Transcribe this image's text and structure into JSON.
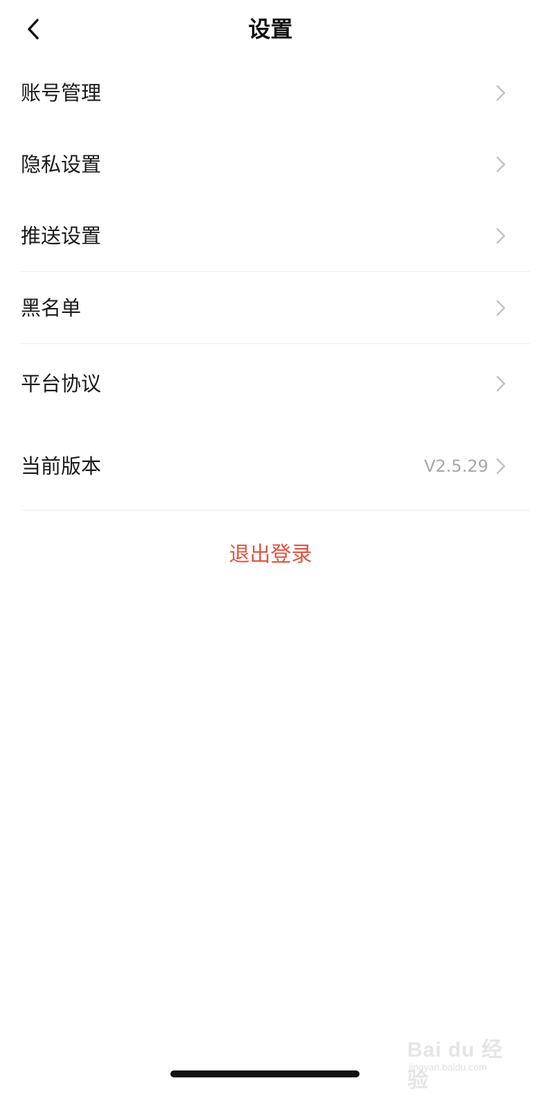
{
  "header": {
    "title": "设置",
    "back_icon": "chevron-left-icon"
  },
  "menu": {
    "items": [
      {
        "label": "账号管理"
      },
      {
        "label": "隐私设置"
      },
      {
        "label": "推送设置"
      },
      {
        "label": "黑名单"
      },
      {
        "label": "平台协议"
      },
      {
        "label": "当前版本",
        "value": "V2.5.29"
      }
    ]
  },
  "logout": {
    "label": "退出登录",
    "color": "#e2533f"
  },
  "watermark": {
    "brand": "Bai du 经验",
    "url": "jingyan.baidu.com"
  }
}
